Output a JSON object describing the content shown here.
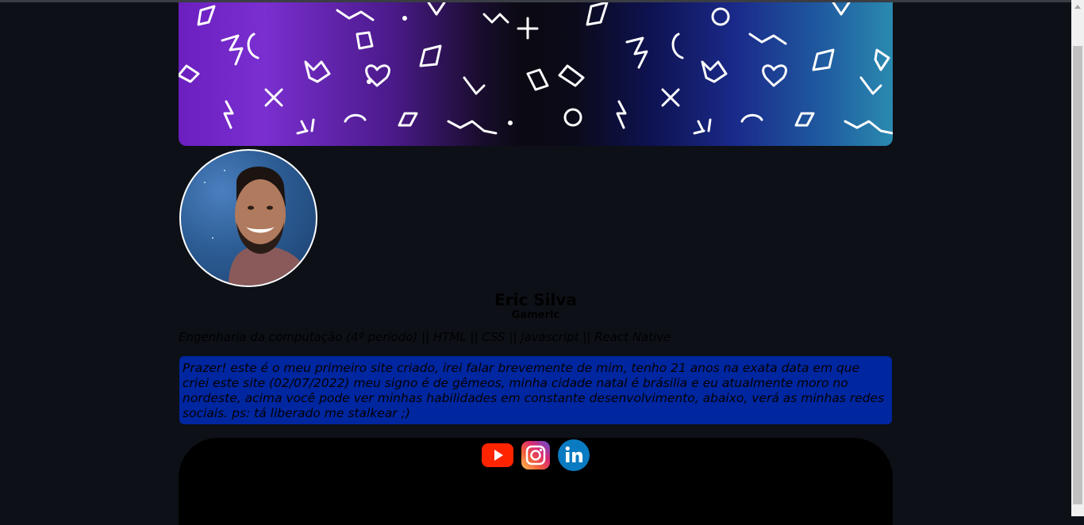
{
  "profile": {
    "name": "Eric Silva",
    "nickname": "Gameric",
    "skills": "Engenharia da computação (4º período) || HTML || CSS || javascript || React Native",
    "about": "Prazer! este é o meu primeiro site criado, irei falar brevemente de mim, tenho 21 anos na exata data em que criei este site (02/07/2022) meu signo é de gêmeos, minha cidade natal é brásilia e eu atualmente moro no nordeste, acima você pode ver minhas habilidades em constante desenvolvimento, abaixo, verá as minhas redes sociais. ps: tá liberado me stalkear ;)"
  },
  "social": {
    "items": [
      {
        "icon": "youtube-icon",
        "label": "YouTube"
      },
      {
        "icon": "instagram-icon",
        "label": "Instagram"
      },
      {
        "icon": "linkedin-icon",
        "label": "LinkedIn"
      }
    ]
  },
  "colors": {
    "background": "#0d1017",
    "about_box": "#0026a0",
    "youtube": "#ff0000",
    "linkedin": "#0a66c2"
  }
}
